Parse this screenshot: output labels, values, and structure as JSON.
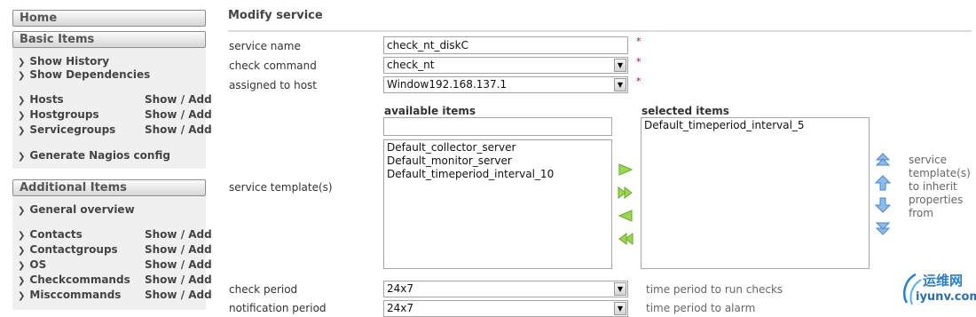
{
  "sidebar": {
    "home": "Home",
    "basic_items": {
      "title": "Basic Items",
      "history": "Show History",
      "dependencies": "Show Dependencies",
      "rows": [
        {
          "label": "Hosts",
          "action": "Show / Add"
        },
        {
          "label": "Hostgroups",
          "action": "Show / Add"
        },
        {
          "label": "Servicegroups",
          "action": "Show / Add"
        }
      ],
      "generate": "Generate Nagios config"
    },
    "additional_items": {
      "title": "Additional Items",
      "overview": "General overview",
      "rows": [
        {
          "label": "Contacts",
          "action": "Show / Add"
        },
        {
          "label": "Contactgroups",
          "action": "Show / Add"
        },
        {
          "label": "OS",
          "action": "Show / Add"
        },
        {
          "label": "Checkcommands",
          "action": "Show / Add"
        },
        {
          "label": "Misccommands",
          "action": "Show / Add"
        }
      ]
    }
  },
  "form": {
    "title": "Modify service",
    "service_name": {
      "label": "service name",
      "value": "check_nt_diskC",
      "required": "*"
    },
    "check_command": {
      "label": "check command",
      "value": "check_nt",
      "required": "*"
    },
    "assigned_host": {
      "label": "assigned to host",
      "value": "Window192.168.137.1",
      "required": "*"
    },
    "service_template": {
      "label": "service template(s)",
      "available_header": "available items",
      "filter_value": "",
      "available": [
        "Default_collector_server",
        "Default_monitor_server",
        "Default_timeperiod_interval_10"
      ],
      "selected_header": "selected items",
      "selected": [
        "Default_timeperiod_interval_5"
      ],
      "hint": [
        "service",
        "template(s)",
        "to inherit",
        "properties",
        "from"
      ]
    },
    "check_period": {
      "label": "check period",
      "value": "24x7",
      "hint": "time period to run checks"
    },
    "notification_period": {
      "label": "notification period",
      "value": "24x7",
      "hint": "time period to alarm"
    }
  },
  "watermark": {
    "top": "运维网",
    "bottom": "iyunv.com"
  },
  "colors": {
    "required": "#d40000",
    "arrow_green": "#8ccf3c",
    "arrow_blue": "#5aa0e6"
  }
}
